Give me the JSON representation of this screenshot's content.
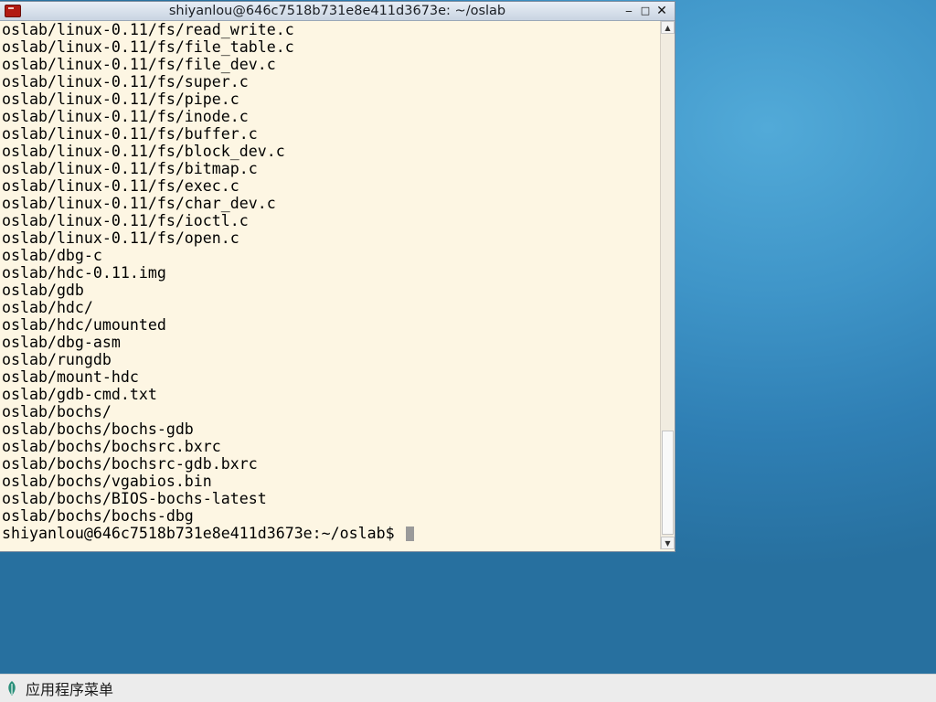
{
  "window": {
    "title": "shiyanlou@646c7518b731e8e411d3673e: ~/oslab",
    "controls": {
      "minimize": "‒",
      "maximize": "□",
      "close": "✕"
    }
  },
  "terminal": {
    "lines": [
      "oslab/linux-0.11/fs/read_write.c",
      "oslab/linux-0.11/fs/file_table.c",
      "oslab/linux-0.11/fs/file_dev.c",
      "oslab/linux-0.11/fs/super.c",
      "oslab/linux-0.11/fs/pipe.c",
      "oslab/linux-0.11/fs/inode.c",
      "oslab/linux-0.11/fs/buffer.c",
      "oslab/linux-0.11/fs/block_dev.c",
      "oslab/linux-0.11/fs/bitmap.c",
      "oslab/linux-0.11/fs/exec.c",
      "oslab/linux-0.11/fs/char_dev.c",
      "oslab/linux-0.11/fs/ioctl.c",
      "oslab/linux-0.11/fs/open.c",
      "oslab/dbg-c",
      "oslab/hdc-0.11.img",
      "oslab/gdb",
      "oslab/hdc/",
      "oslab/hdc/umounted",
      "oslab/dbg-asm",
      "oslab/rungdb",
      "oslab/mount-hdc",
      "oslab/gdb-cmd.txt",
      "oslab/bochs/",
      "oslab/bochs/bochs-gdb",
      "oslab/bochs/bochsrc.bxrc",
      "oslab/bochs/bochsrc-gdb.bxrc",
      "oslab/bochs/vgabios.bin",
      "oslab/bochs/BIOS-bochs-latest",
      "oslab/bochs/bochs-dbg"
    ],
    "prompt": "shiyanlou@646c7518b731e8e411d3673e:~/oslab$ ",
    "scroll_position": 0.92
  },
  "scrollbar": {
    "up_arrow": "▲",
    "down_arrow": "▼"
  },
  "taskbar": {
    "app_menu_label": "应用程序菜单",
    "app_menu_icon": "leaf-icon"
  },
  "colors": {
    "terminal_background": "#fdf6e3",
    "terminal_text": "#000000",
    "desktop": "#3f95c8",
    "taskbar": "#ececec"
  }
}
